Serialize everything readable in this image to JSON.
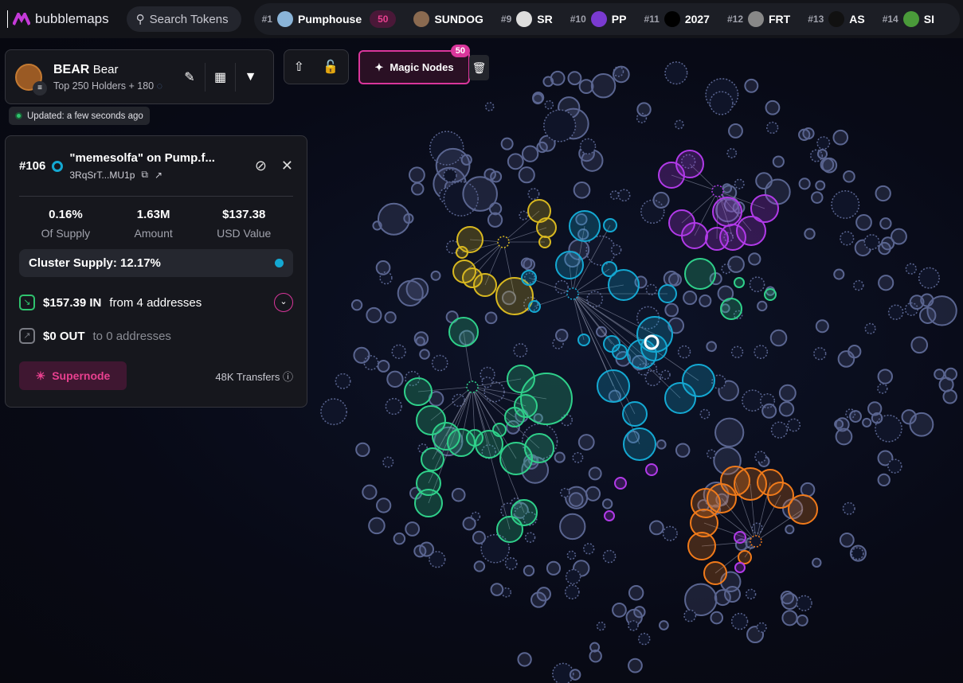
{
  "app": {
    "name": "bubblemaps"
  },
  "search": {
    "placeholder": "Search Tokens"
  },
  "trending": [
    {
      "rank": "#1",
      "name": "Pumphouse",
      "boost": "50",
      "icon": "pumphouse-icon",
      "color": "#8ab4d8"
    },
    {
      "rank": "",
      "name": "SUNDOG",
      "icon": "sundog-icon",
      "color": "#8a6a50"
    },
    {
      "rank": "#9",
      "name": "SR",
      "icon": "sr-icon",
      "color": "#dddddd"
    },
    {
      "rank": "#10",
      "name": "PP",
      "icon": "pp-icon",
      "color": "#7a3ad0"
    },
    {
      "rank": "#11",
      "name": "2027",
      "icon": "2027-icon",
      "color": "#000000"
    },
    {
      "rank": "#12",
      "name": "FRT",
      "icon": "frt-icon",
      "color": "#888888"
    },
    {
      "rank": "#13",
      "name": "AS",
      "icon": "as-icon",
      "color": "#111111"
    },
    {
      "rank": "#14",
      "name": "SI",
      "icon": "si-icon",
      "color": "#4a9a3a"
    }
  ],
  "token": {
    "symbol": "BEAR",
    "name": "Bear",
    "subtitle": "Top 250 Holders + 180",
    "updated": "Updated: a few seconds ago"
  },
  "magic": {
    "label": "Magic Nodes",
    "count": "50"
  },
  "detail": {
    "rank": "#106",
    "name": "\"memesolfa\" on Pump.f...",
    "address": "3RqSrT...MU1p",
    "stats": [
      {
        "value": "0.16%",
        "label": "Of Supply"
      },
      {
        "value": "1.63M",
        "label": "Amount"
      },
      {
        "value": "$137.38",
        "label": "USD Value"
      }
    ],
    "cluster_supply": "Cluster Supply: 12.17%",
    "in_amount": "$157.39 IN",
    "in_from": "from 4 addresses",
    "out_amount": "$0 OUT",
    "out_to": "to 0 addresses",
    "supernode": "Supernode",
    "transfers": "48K Transfers"
  },
  "colors": {
    "accent": "#d9369b",
    "cyan": "#14a8d2",
    "green": "#2fd08a",
    "yellow": "#d8b820",
    "purple": "#b13ae8",
    "orange": "#f07a1a",
    "gray": "#5a6590"
  }
}
